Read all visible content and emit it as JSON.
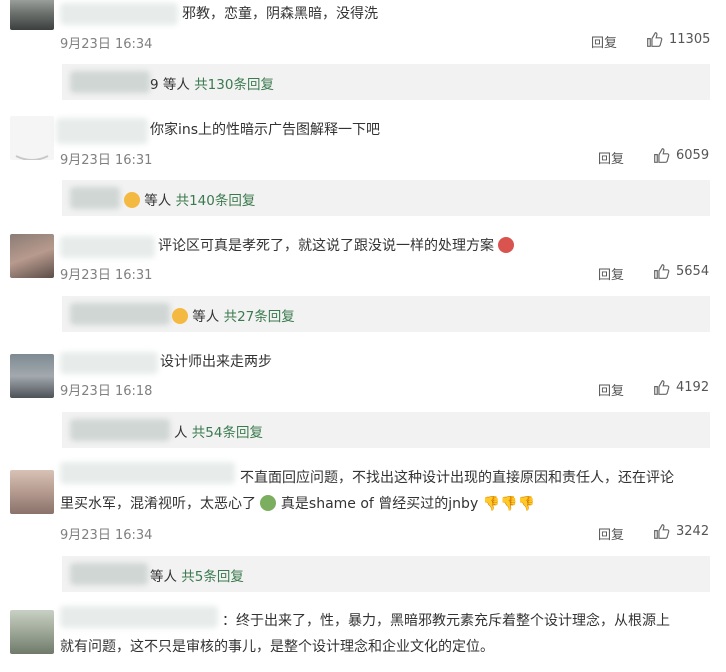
{
  "comments": [
    {
      "text": "邪教，恋童，阴森黑暗，没得洗",
      "date": "9月23日 16:34",
      "reply_label": "回复",
      "likes": "11305",
      "sub": {
        "prefix": "9 等人",
        "link": "共130条回复"
      }
    },
    {
      "text": "你家ins上的性暗示广告图解释一下吧",
      "date": "9月23日 16:31",
      "reply_label": "回复",
      "likes": "6059",
      "sub": {
        "prefix": "等人",
        "link": "共140条回复"
      }
    },
    {
      "text": "评论区可真是孝死了，就这说了跟没说一样的处理方案",
      "date": "9月23日 16:31",
      "reply_label": "回复",
      "likes": "5654",
      "sub": {
        "prefix": "等人",
        "link": "共27条回复"
      }
    },
    {
      "text": "设计师出来走两步",
      "date": "9月23日 16:18",
      "reply_label": "回复",
      "likes": "4192",
      "sub": {
        "prefix": "人",
        "link": "共54条回复"
      }
    },
    {
      "text_line1": "不直面回应问题，不找出这种设计出现的直接原因和责任人，还在评论",
      "text_line2a": "里买水军，混淆视听，太恶心了",
      "text_line2b": "真是shame of 曾经买过的jnby",
      "date": "9月23日 16:34",
      "reply_label": "回复",
      "likes": "3242",
      "sub": {
        "prefix": "等人",
        "link": "共5条回复"
      }
    },
    {
      "text_line1": "：终于出来了，性，暴力，黑暗邪教元素充斥着整个设计理念，从根源上",
      "text_line2": "就有问题，这不只是审核的事儿，是整个设计理念和企业文化的定位。"
    }
  ]
}
